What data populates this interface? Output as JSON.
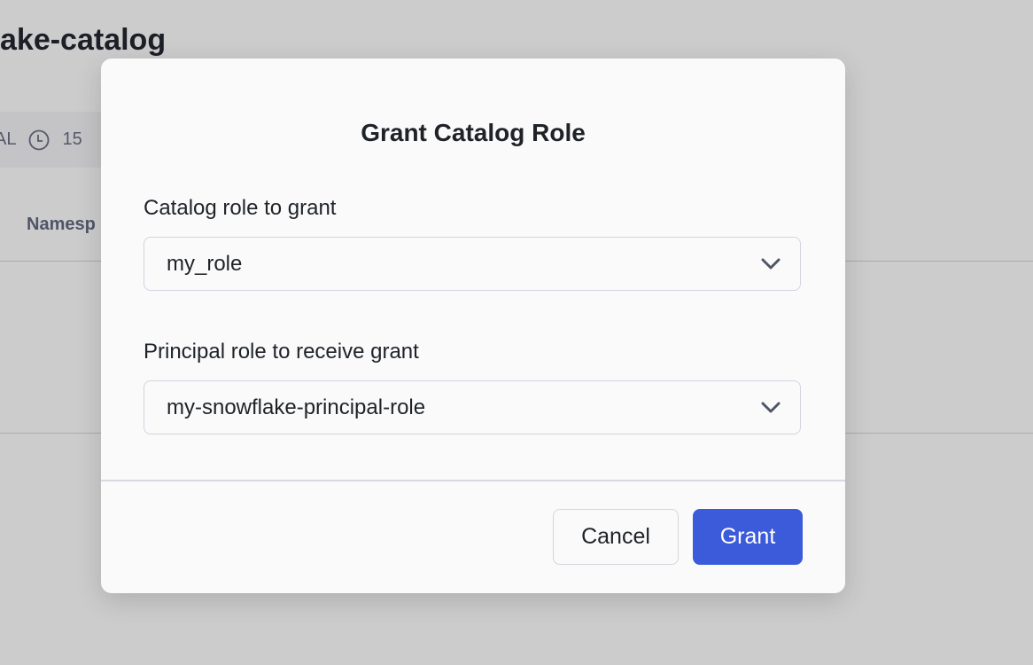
{
  "background": {
    "title": "ake-catalog",
    "meta_text": "AL",
    "meta_count": "15",
    "column_header": "Namesp"
  },
  "dialog": {
    "title": "Grant Catalog Role",
    "catalog_role_label": "Catalog role to grant",
    "catalog_role_value": "my_role",
    "principal_role_label": "Principal role to receive grant",
    "principal_role_value": "my-snowflake-principal-role",
    "cancel_label": "Cancel",
    "grant_label": "Grant"
  },
  "colors": {
    "primary": "#3b5bdb",
    "overlay": "#cccccc"
  },
  "icons": {
    "clock": "clock-icon",
    "chevron": "chevron-down-icon"
  }
}
